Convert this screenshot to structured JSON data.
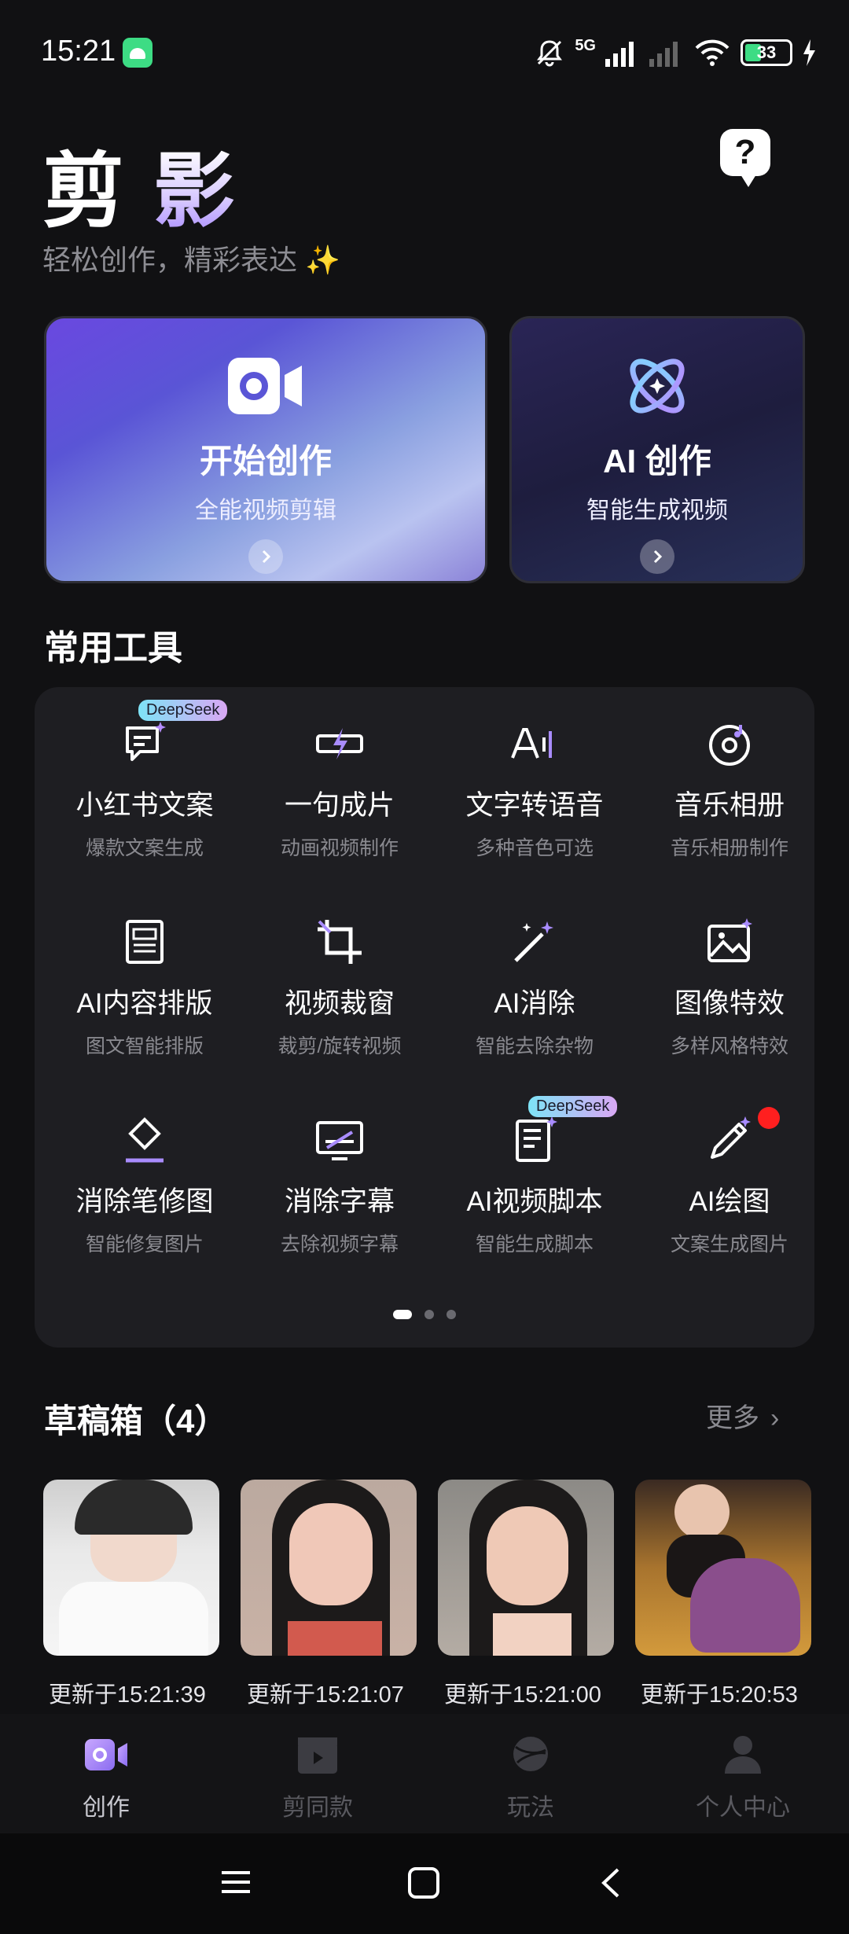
{
  "status": {
    "time": "15:21",
    "network": "5G",
    "battery": "33"
  },
  "header": {
    "logo_part1": "剪",
    "logo_part2": "影",
    "tagline": "轻松创作，精彩表达 ✨",
    "help_icon": "question-bubble-icon"
  },
  "hero": [
    {
      "title": "开始创作",
      "subtitle": "全能视频剪辑",
      "icon": "video-camera-icon"
    },
    {
      "title": "AI 创作",
      "subtitle": "智能生成视频",
      "icon": "ai-atom-icon"
    }
  ],
  "tools_section": {
    "title": "常用工具"
  },
  "tools": [
    {
      "name": "小红书文案",
      "desc": "爆款文案生成",
      "icon": "chat-doc-icon",
      "badge": "DeepSeek"
    },
    {
      "name": "一句成片",
      "desc": "动画视频制作",
      "icon": "flash-film-icon"
    },
    {
      "name": "文字转语音",
      "desc": "多种音色可选",
      "icon": "text-to-speech-icon"
    },
    {
      "name": "音乐相册",
      "desc": "音乐相册制作",
      "icon": "music-disc-icon"
    },
    {
      "name": "AI内容排版",
      "desc": "图文智能排版",
      "icon": "layout-doc-icon"
    },
    {
      "name": "视频裁窗",
      "desc": "裁剪/旋转视频",
      "icon": "crop-icon"
    },
    {
      "name": "AI消除",
      "desc": "智能去除杂物",
      "icon": "magic-wand-icon"
    },
    {
      "name": "图像特效",
      "desc": "多样风格特效",
      "icon": "image-sparkle-icon"
    },
    {
      "name": "消除笔修图",
      "desc": "智能修复图片",
      "icon": "eraser-icon"
    },
    {
      "name": "消除字幕",
      "desc": "去除视频字幕",
      "icon": "subtitle-remove-icon"
    },
    {
      "name": "AI视频脚本",
      "desc": "智能生成脚本",
      "icon": "script-doc-icon",
      "badge": "DeepSeek"
    },
    {
      "name": "AI绘图",
      "desc": "文案生成图片",
      "icon": "pencil-icon"
    }
  ],
  "drafts": {
    "title": "草稿箱（4）",
    "more": "更多",
    "items": [
      {
        "time": "更新于15:21:39"
      },
      {
        "time": "更新于15:21:07"
      },
      {
        "time": "更新于15:21:00"
      },
      {
        "time": "更新于15:20:53"
      }
    ]
  },
  "bottom_nav": [
    {
      "label": "创作",
      "icon": "video-camera-icon",
      "active": true
    },
    {
      "label": "剪同款",
      "icon": "clapper-icon",
      "active": false
    },
    {
      "label": "玩法",
      "icon": "planet-icon",
      "active": false
    },
    {
      "label": "个人中心",
      "icon": "person-icon",
      "active": false
    }
  ],
  "colors": {
    "accent": "#a98cff",
    "background": "#111113",
    "card": "#1e1e22",
    "red_dot": "#ff1f1f"
  }
}
